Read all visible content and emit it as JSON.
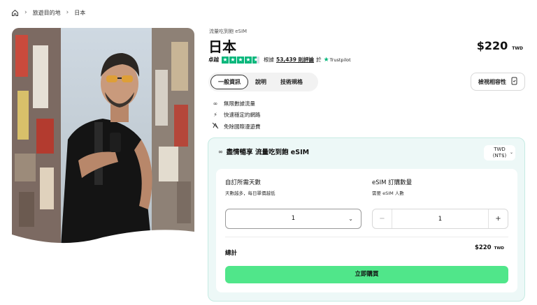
{
  "breadcrumb": {
    "home_icon": "home-icon",
    "items": [
      "旅遊目的地",
      "日本"
    ]
  },
  "product": {
    "subtitle": "流量吃到飽 eSIM",
    "title": "日本",
    "price": "$220",
    "currency": "TWD"
  },
  "rating": {
    "word": "卓越",
    "stars": 4.5,
    "prefix": "根據",
    "count": "53,439 則評論",
    "suffix": "於",
    "source": "Trustpilot",
    "star_color": "#00b67a"
  },
  "tabs": [
    {
      "label": "一般資訊",
      "active": true
    },
    {
      "label": "說明",
      "active": false
    },
    {
      "label": "技術規格",
      "active": false
    }
  ],
  "compat_button": {
    "label": "檢視相容性",
    "icon": "phone-check-icon"
  },
  "features": [
    {
      "icon": "infinity-icon",
      "label": "無限數據流量"
    },
    {
      "icon": "lightning-icon",
      "label": "快速穩定的網路"
    },
    {
      "icon": "no-roaming-icon",
      "label": "免除國際漫遊費"
    }
  ],
  "plan_card": {
    "title": "盡情暢享 流量吃到飽 eSIM",
    "currency_select": {
      "line1": "TWD",
      "line2": "(NT$)"
    },
    "days": {
      "label": "自訂所需天數",
      "hint": "天數越多，每日單價越低",
      "value": "1"
    },
    "quantity": {
      "label": "eSIM 訂購數量",
      "hint": "需要 eSIM 人數",
      "value": "1",
      "minus": "−",
      "plus": "+"
    },
    "total": {
      "label": "總計",
      "value": "$220",
      "currency": "TWD"
    },
    "buy_label": "立即購買",
    "accent": "#50e68a"
  }
}
